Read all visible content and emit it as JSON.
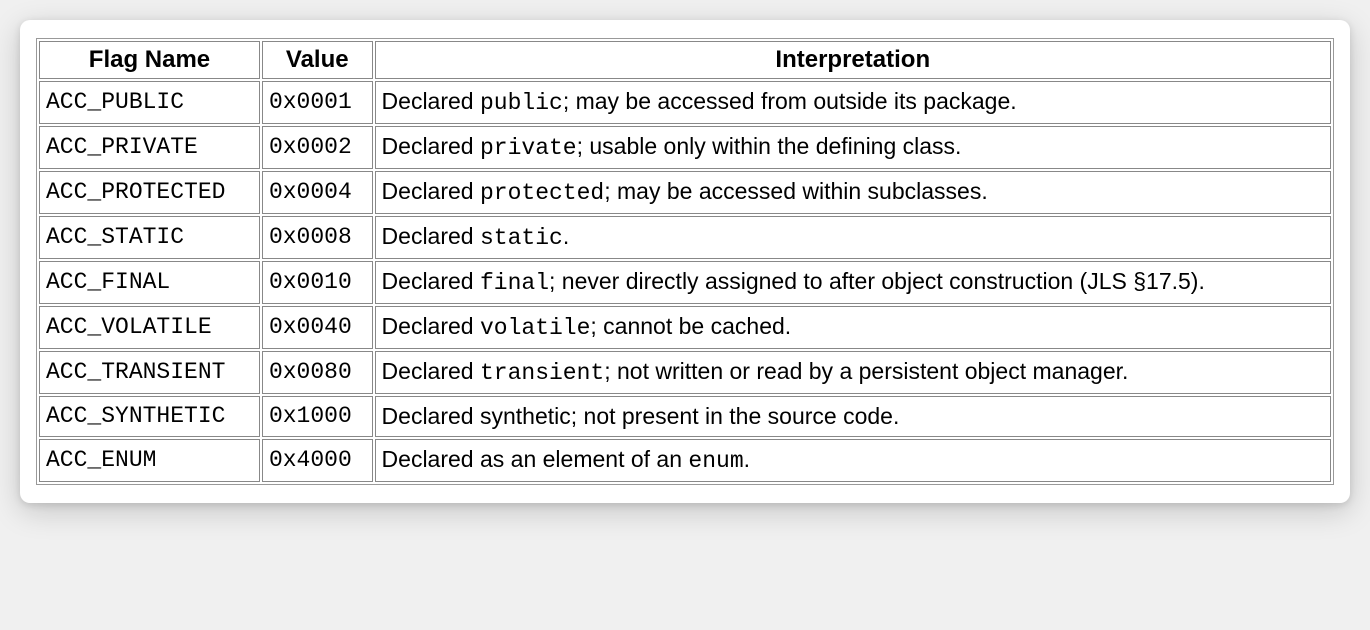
{
  "table": {
    "headers": [
      "Flag Name",
      "Value",
      "Interpretation"
    ],
    "rows": [
      {
        "flag": "ACC_PUBLIC",
        "value": "0x0001",
        "interp_lead": "Declared ",
        "interp_code": "public",
        "interp_tail": "; may be accessed from outside its package."
      },
      {
        "flag": "ACC_PRIVATE",
        "value": "0x0002",
        "interp_lead": "Declared ",
        "interp_code": "private",
        "interp_tail": "; usable only within the defining class."
      },
      {
        "flag": "ACC_PROTECTED",
        "value": "0x0004",
        "interp_lead": "Declared ",
        "interp_code": "protected",
        "interp_tail": "; may be accessed within subclasses."
      },
      {
        "flag": "ACC_STATIC",
        "value": "0x0008",
        "interp_lead": "Declared ",
        "interp_code": "static",
        "interp_tail": "."
      },
      {
        "flag": "ACC_FINAL",
        "value": "0x0010",
        "interp_lead": "Declared ",
        "interp_code": "final",
        "interp_tail": "; never directly assigned to after object construction (JLS §17.5)."
      },
      {
        "flag": "ACC_VOLATILE",
        "value": "0x0040",
        "interp_lead": "Declared ",
        "interp_code": "volatile",
        "interp_tail": "; cannot be cached."
      },
      {
        "flag": "ACC_TRANSIENT",
        "value": "0x0080",
        "interp_lead": "Declared ",
        "interp_code": "transient",
        "interp_tail": "; not written or read by a persistent object manager."
      },
      {
        "flag": "ACC_SYNTHETIC",
        "value": "0x1000",
        "interp_lead": "Declared synthetic; not present in the source code.",
        "interp_code": "",
        "interp_tail": ""
      },
      {
        "flag": "ACC_ENUM",
        "value": "0x4000",
        "interp_lead": "Declared as an element of an ",
        "interp_code": "enum",
        "interp_tail": "."
      }
    ]
  }
}
